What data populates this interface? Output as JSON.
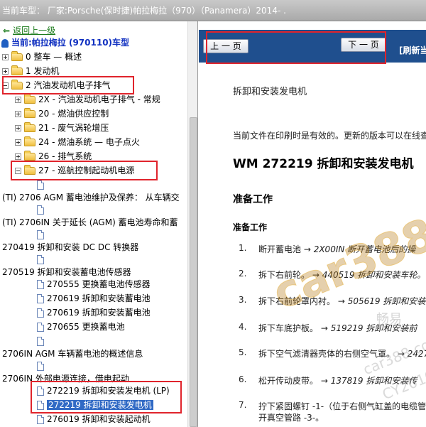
{
  "topbar": {
    "text": "当前车型：  厂家:Porsche(保时捷)帕拉梅拉（970）（Panamera）2014-   ."
  },
  "tree": {
    "back_label": "返回上一级",
    "current_model": "当前:帕拉梅拉 (970110)车型",
    "items": [
      {
        "label": "0 整车 — 概述"
      },
      {
        "label": "1 发动机"
      },
      {
        "label": "2 汽油发动机电子排气"
      },
      {
        "label": "2X - 汽油发动机电子排气 - 常规"
      },
      {
        "label": "20 - 燃油供应控制"
      },
      {
        "label": "21 - 废气涡轮增压"
      },
      {
        "label": "24 - 燃油系统 — 电子点火"
      },
      {
        "label": "26 - 排气系统"
      },
      {
        "label": "27 - 巡航控制起动机电源"
      }
    ],
    "docs": [
      {
        "label": "(TI) 2706 AGM 蓄电池维护及保养： 从车辆交"
      },
      {
        "label": "(TI) 2706IN 关于延长 (AGM) 蓄电池寿命和蓄"
      },
      {
        "label": "270419 拆卸和安装 DC DC 转换器"
      },
      {
        "label": "270519 拆卸和安装蓄电池传感器"
      },
      {
        "label": "270555 更换蓄电池传感器"
      },
      {
        "label": "270619 拆卸和安装蓄电池"
      },
      {
        "label": "270619 拆卸和安装蓄电池"
      },
      {
        "label": "270655 更换蓄电池"
      },
      {
        "label": "2706IN AGM 车辆蓄电池的概述信息"
      },
      {
        "label": "2706IN 外部电源连接，借电起动"
      },
      {
        "label": "272219 拆卸和安装发电机 (LP)"
      },
      {
        "label": "272219 拆卸和安装发电机"
      },
      {
        "label": "276019 拆卸和安装起动机"
      }
    ]
  },
  "doc": {
    "prev_label": "上 一 页",
    "next_label": "下 一 页",
    "refresh_label": "[刷新当",
    "section_title": "拆卸和安装发电机",
    "print_notice": "当前文件在印刷时是有效的。更新的版本可以在线查",
    "main_title": "WM 272219 拆卸和安装发电机",
    "prep_heading": "准备工作",
    "prep_subheading": "准备工作",
    "steps": [
      {
        "num": "1.",
        "text": "断开蓄电池",
        "ref": " → 2X00IN 断开蓄电池后的操"
      },
      {
        "num": "2.",
        "text": "拆下右前轮。",
        "ref": " → 440519 拆卸和安装车轮。"
      },
      {
        "num": "3.",
        "text": "拆下右前轮罩内衬。",
        "ref": " → 505619 拆卸和安装"
      },
      {
        "num": "4.",
        "text": "拆下车底护板。",
        "ref": " → 519219 拆卸和安装前"
      },
      {
        "num": "5.",
        "text": "拆下空气滤清器壳体的右侧空气罩。",
        "ref": " → 2427"
      },
      {
        "num": "6.",
        "text": "松开传动皮带。",
        "ref": " → 137819 拆卸和安装传"
      },
      {
        "num": "7.",
        "text": "拧下紧固螺钉 -1-（位于右侧气缸盖的电缆管",
        "ref": ""
      },
      {
        "num": "",
        "text": "开真空管路 -3-。",
        "ref": ""
      }
    ]
  },
  "watermark": {
    "main": "car388.com",
    "cn": "畅易",
    "secondary": "car388.com",
    "code": "CY2010"
  }
}
